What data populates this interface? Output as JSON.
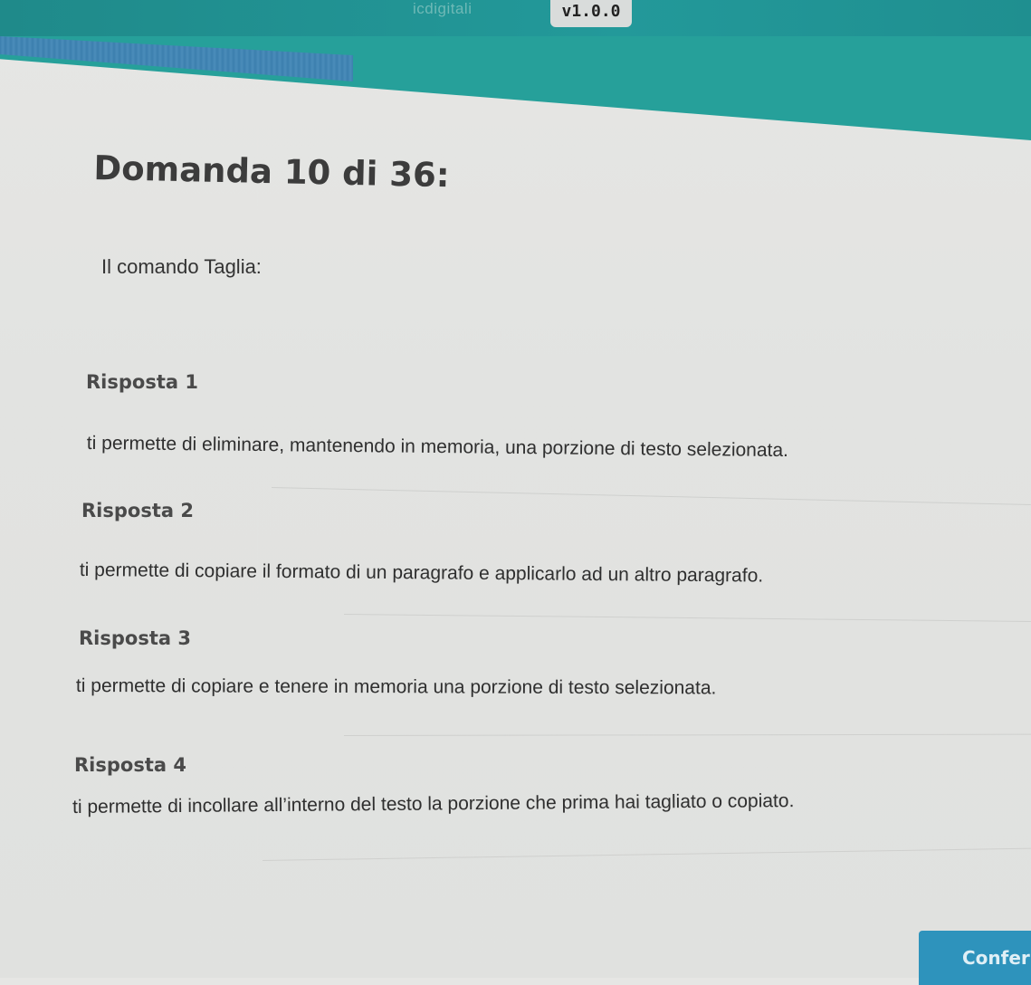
{
  "header": {
    "brand_partial": "icdigitali",
    "version": "v1.0.0"
  },
  "question": {
    "title": "Domanda 10 di 36:",
    "text": "Il comando Taglia:"
  },
  "answers": [
    {
      "label": "Risposta 1",
      "text": "ti permette di eliminare, mantenendo in memoria, una porzione di testo selezionata."
    },
    {
      "label": "Risposta 2",
      "text": "ti permette di copiare il formato di un paragrafo e applicarlo ad un altro paragrafo."
    },
    {
      "label": "Risposta 3",
      "text": "ti permette di copiare e tenere in memoria una porzione di testo selezionata."
    },
    {
      "label": "Risposta 4",
      "text": "ti permette di incollare all’interno del testo la porzione che prima hai tagliato o copiato."
    }
  ],
  "footer": {
    "confirm_label": "Conferma"
  },
  "colors": {
    "header_teal": "#26a09a",
    "header_stripe_blue": "#3c7fae",
    "confirm_button": "#2e93bc",
    "page_background": "#e4e5e3"
  }
}
